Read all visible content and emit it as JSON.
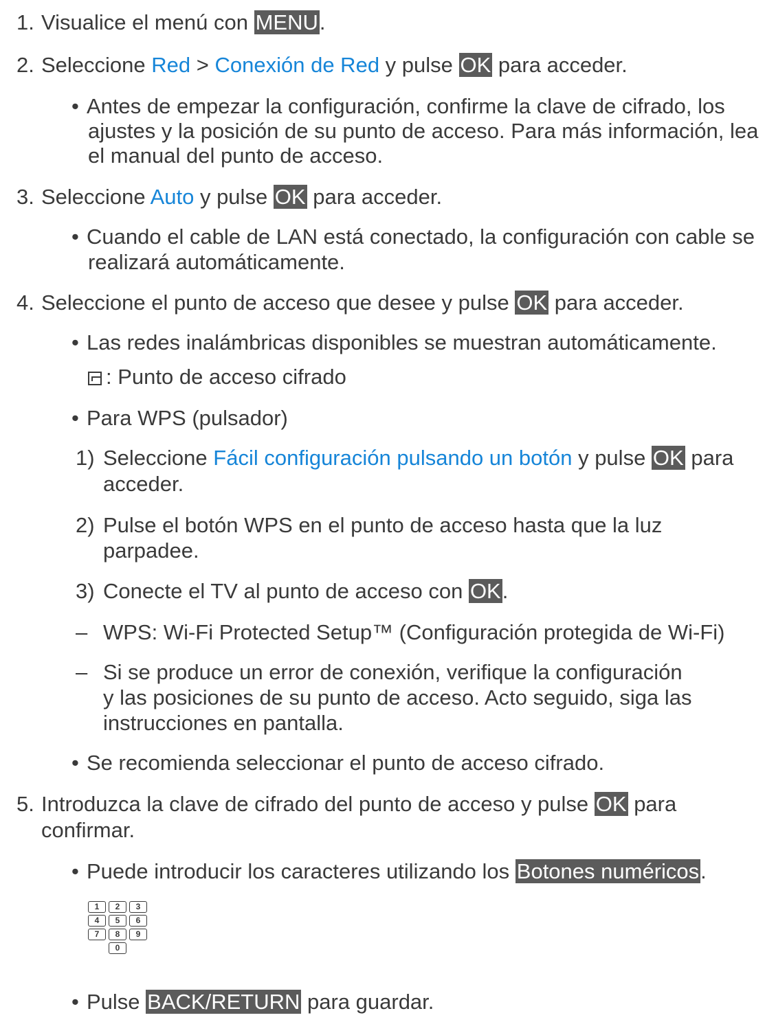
{
  "steps": {
    "s1": {
      "num": "1.",
      "text": "Visualice el menú con ",
      "key": "MENU",
      "end": "."
    },
    "s2": {
      "num": "2.",
      "a": "Seleccione ",
      "link1": "Red",
      "b": " > ",
      "link2": "Conexión de Red",
      "c": " y pulse ",
      "key": "OK",
      "d": " para acceder."
    },
    "s2_bullet": {
      "l1": "Antes de empezar la configuración, confirme la clave de cifrado, los",
      "l2": "ajustes y la posición de su punto de acceso. Para más información, lea",
      "l3": "el manual del punto de acceso."
    },
    "s3": {
      "num": "3.",
      "a": "Seleccione ",
      "link": "Auto",
      "b": " y pulse ",
      "key": "OK",
      "c": " para acceder."
    },
    "s3_bullet": {
      "l1": "Cuando el cable de LAN está conectado, la configuración con cable se",
      "l2": "realizará automáticamente."
    },
    "s4": {
      "num": "4.",
      "a": "Seleccione el punto de acceso que desee y pulse ",
      "key": "OK",
      "b": " para acceder."
    },
    "s4_bullet1": "Las redes inalámbricas disponibles se muestran automáticamente.",
    "s4_icon_text": ": Punto de acceso cifrado",
    "s4_bullet2": "Para WPS (pulsador)",
    "wps1": {
      "num": "1)",
      "a": "Seleccione ",
      "link": "Fácil configuración pulsando un botón",
      "b": " y pulse ",
      "key": "OK",
      "c": " para",
      "l2": "acceder."
    },
    "wps2": {
      "num": "2)",
      "l1": "Pulse el botón WPS en el punto de acceso hasta que la luz",
      "l2": "parpadee."
    },
    "wps3": {
      "num": "3)",
      "a": "Conecte el TV al punto de acceso con ",
      "key": "OK",
      "b": "."
    },
    "note1": {
      "mark": "–",
      "text": "WPS: Wi-Fi Protected Setup™ (Configuración protegida de Wi-Fi)"
    },
    "note2": {
      "mark": "–",
      "l1": "Si se produce un error de conexión, verifique la configuración",
      "l2": "y las posiciones de su punto de acceso. Acto seguido, siga las",
      "l3": "instrucciones en pantalla."
    },
    "s4_bullet3": "Se recomienda seleccionar el punto de acceso cifrado.",
    "s5": {
      "num": "5.",
      "a": "Introduzca la clave de cifrado del punto de acceso y pulse ",
      "key": "OK",
      "b": " para",
      "l2": "confirmar."
    },
    "s5_bullet1": {
      "a": "Puede introducir los caracteres utilizando los ",
      "key": "Botones numéricos",
      "b": "."
    },
    "s5_bullet2": {
      "a": "Pulse ",
      "key": "BACK/RETURN",
      "b": " para guardar."
    }
  },
  "bullet_glyph": "•",
  "numpad_keys": [
    "1",
    "2",
    "3",
    "4",
    "5",
    "6",
    "7",
    "8",
    "9",
    "0"
  ],
  "colors": {
    "link": "#1685d8",
    "key_bg": "#5b5b5b",
    "text": "#3a3a3a"
  }
}
